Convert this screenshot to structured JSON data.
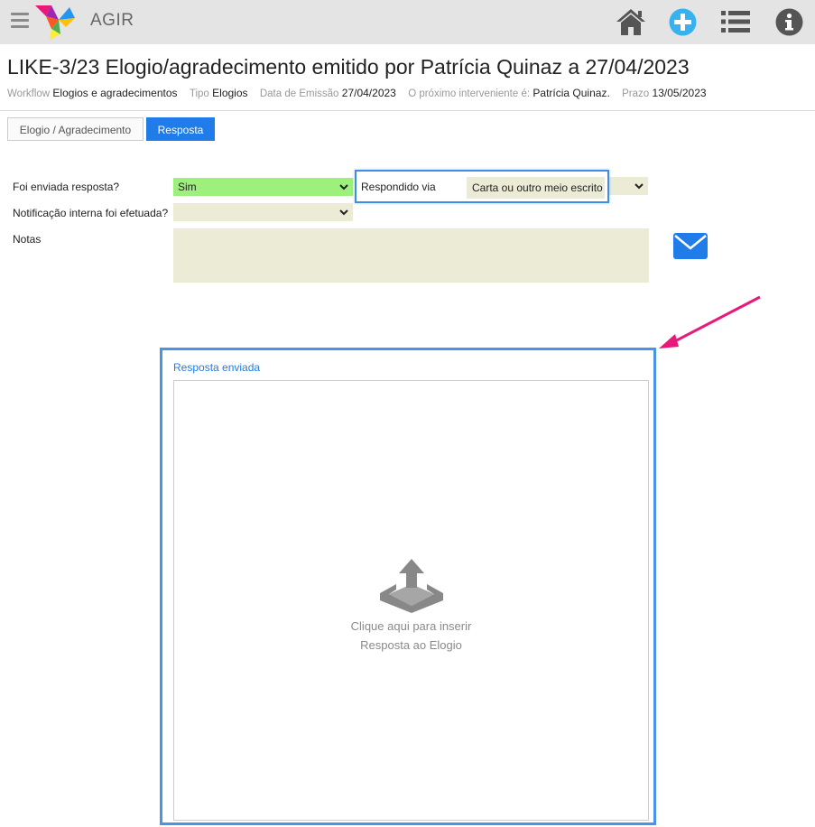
{
  "app": {
    "name": "AGIR",
    "icons": [
      "menu-icon",
      "home-icon",
      "plus-icon",
      "list-icon",
      "info-icon"
    ]
  },
  "header": {
    "title": "LIKE-3/23 Elogio/agradecimento emitido por Patrícia Quinaz a 27/04/2023",
    "meta": {
      "workflow_label": "Workflow",
      "workflow_value": "Elogios e agradecimentos",
      "tipo_label": "Tipo",
      "tipo_value": "Elogios",
      "data_label": "Data de Emissão",
      "data_value": "27/04/2023",
      "interveniente_label": "O próximo interveniente é:",
      "interveniente_value": "Patrícia Quinaz.",
      "prazo_label": "Prazo",
      "prazo_value": "13/05/2023"
    }
  },
  "tabs": [
    {
      "label": "Elogio / Agradecimento",
      "active": false
    },
    {
      "label": "Resposta",
      "active": true
    }
  ],
  "form": {
    "resposta_enviada_label": "Foi enviada resposta?",
    "resposta_enviada_value": "Sim",
    "notificacao_label": "Notificação interna foi efetuada?",
    "notificacao_value": "",
    "respondido_via_label": "Respondido via",
    "respondido_via_value": "Carta ou outro meio escrito",
    "notas_label": "Notas",
    "notas_value": ""
  },
  "upload": {
    "title": "Resposta enviada",
    "line1": "Clique aqui para inserir",
    "line2": "Resposta ao Elogio"
  },
  "colors": {
    "topbar": "#e4e4e4",
    "accent": "#1f7ce8",
    "highlight_border": "#4a94e6",
    "field_bg": "#ecebd5",
    "sim_bg": "#9df07c",
    "arrow": "#e8197a"
  }
}
